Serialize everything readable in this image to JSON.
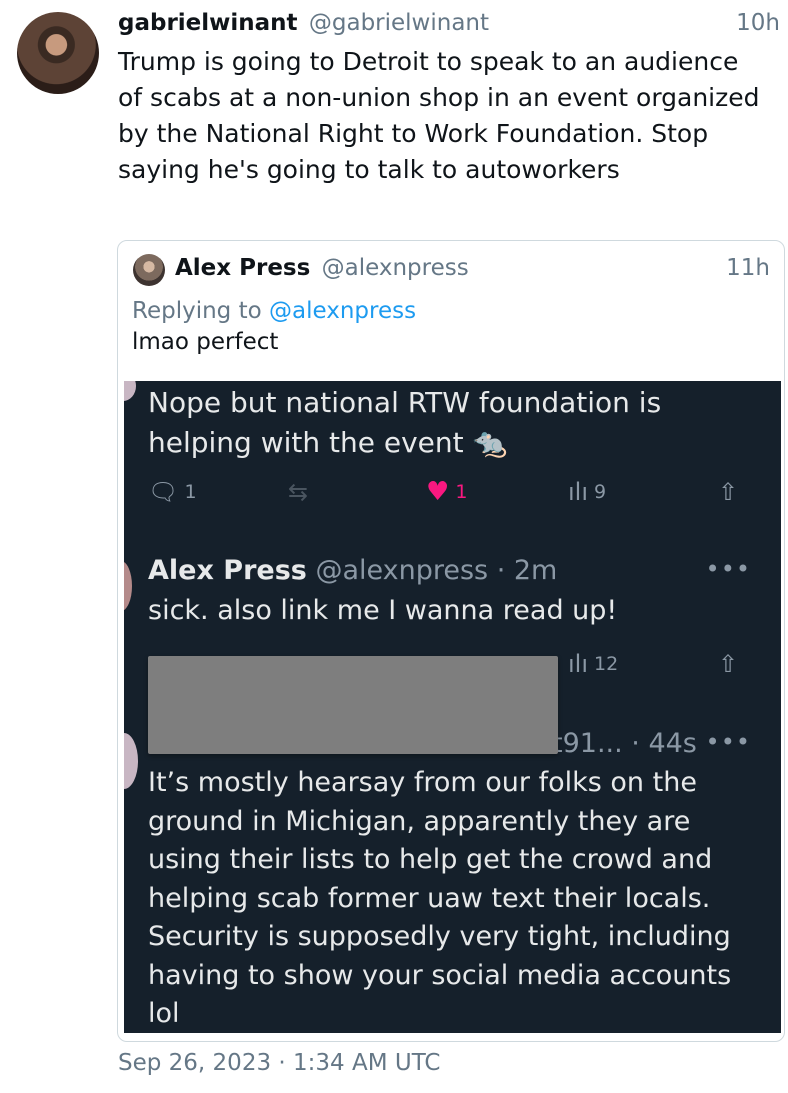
{
  "tweet": {
    "display_name": "gabrielwinant",
    "handle": "@gabrielwinant",
    "time": "10h",
    "text": "Trump is going to Detroit to speak to an audience of scabs at a non-union shop in an event organized by the National Right to Work Foundation. Stop saying he's going to talk to autoworkers",
    "date": "Sep 26, 2023 · 1:34 AM UTC"
  },
  "quote": {
    "display_name": "Alex Press",
    "handle": "@alexnpress",
    "time": "11h",
    "replying_prefix": "Replying to",
    "replying_handle": "@alexnpress",
    "text": "lmao perfect"
  },
  "screenshot": {
    "first_text": "Nope but national RTW foundation is helping with the event 🐀",
    "first_actions": {
      "replies": "1",
      "likes": "1",
      "views": "9"
    },
    "reply": {
      "display_name": "Alex Press",
      "handle": "@alexnpress",
      "time": "· 2m",
      "text": "sick. also link me I wanna read up!",
      "views": "12"
    },
    "third": {
      "meta": "t91... · 44s",
      "text": "It’s mostly hearsay from our folks on the ground in Michigan, apparently they are using their lists to help get the crowd and helping scab former uaw text their locals. Security is supposedly very tight, including having to show your social media accounts lol"
    }
  },
  "icons": {
    "reply": "reply-icon",
    "retweet": "retweet-icon",
    "like": "heart-icon",
    "views": "views-icon",
    "share": "share-icon",
    "more": "more-icon"
  },
  "colors": {
    "link": "#1d9bf0",
    "like": "#f91880",
    "dark_bg": "#15202b"
  }
}
